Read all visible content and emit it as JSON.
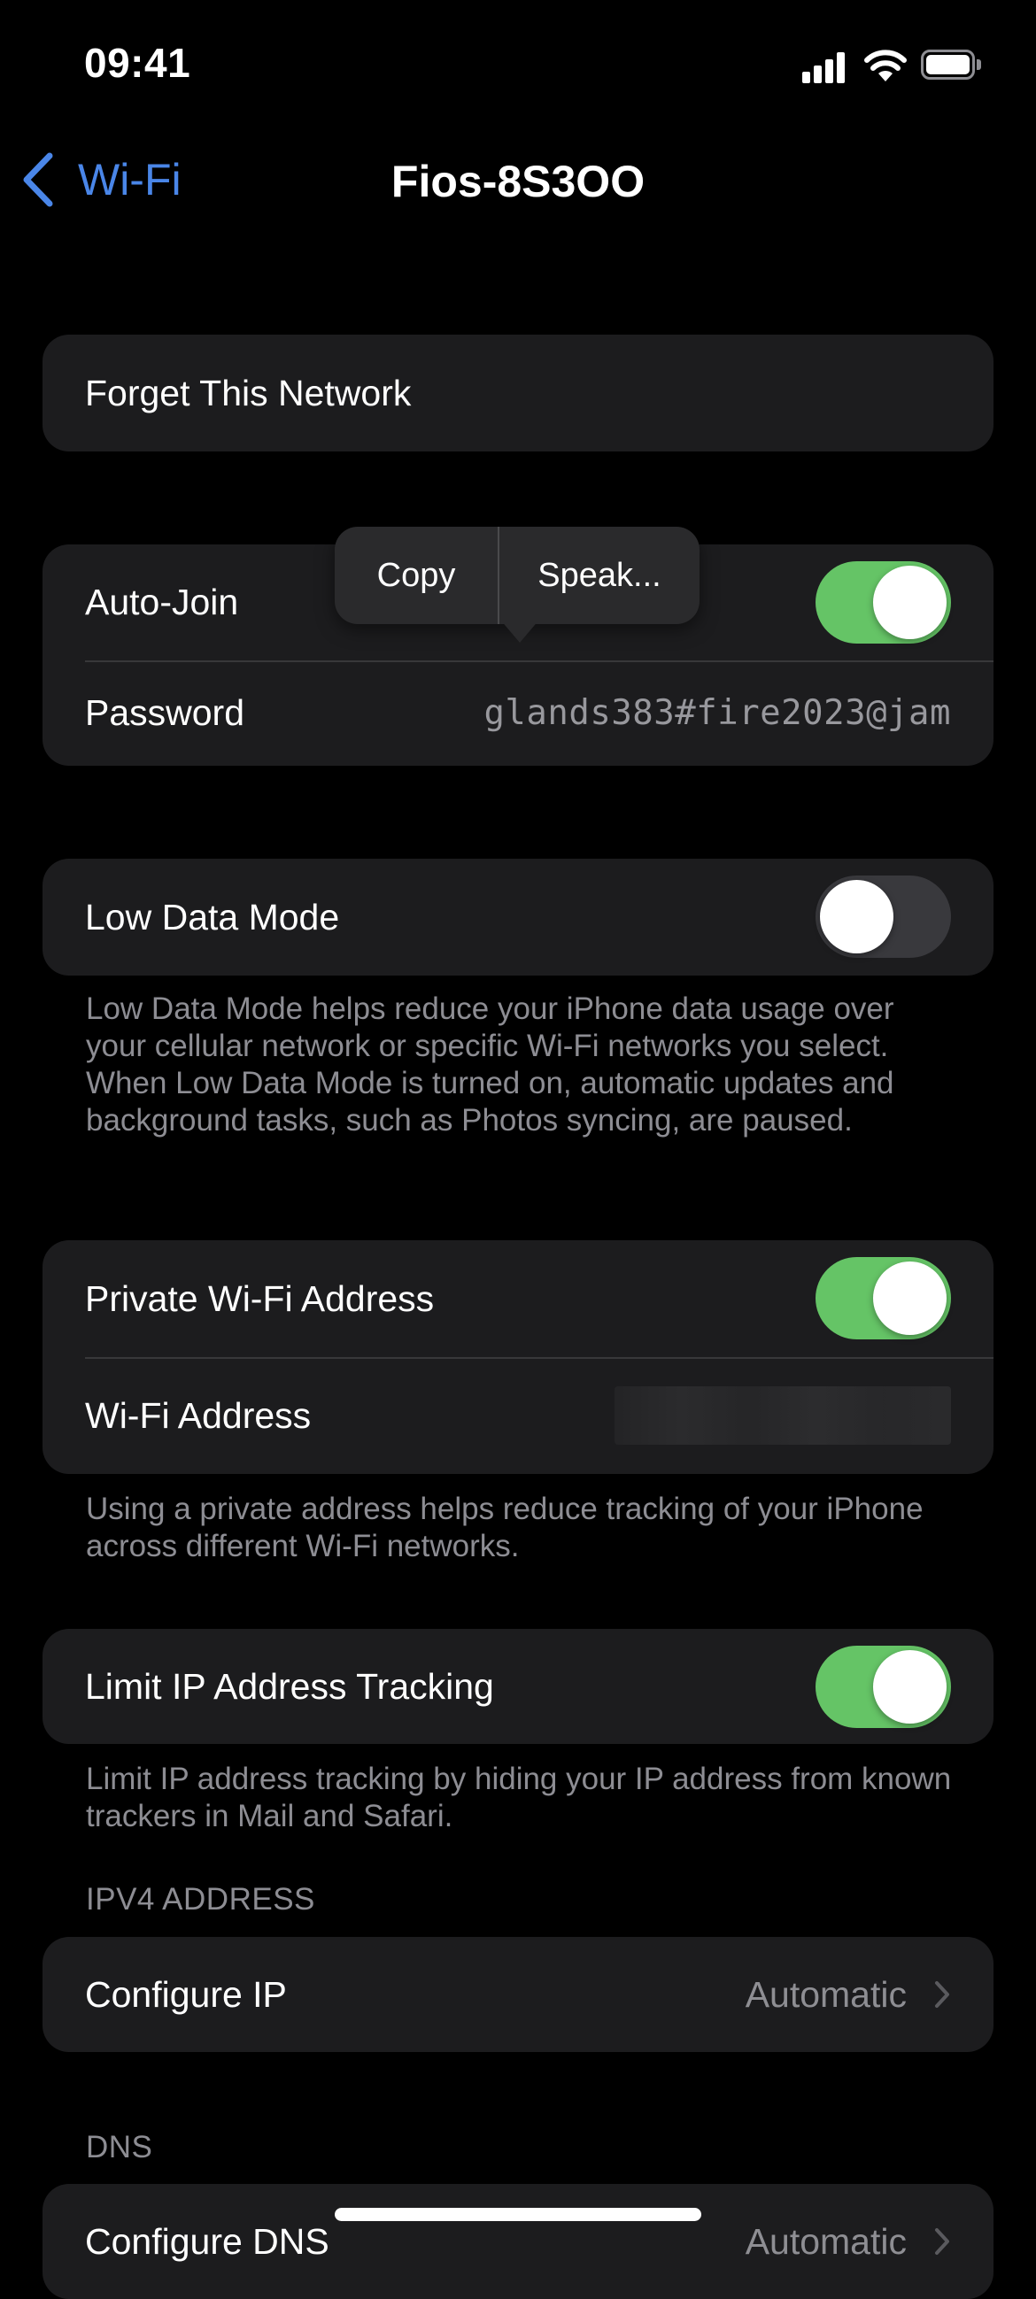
{
  "status_bar": {
    "time": "09:41"
  },
  "nav": {
    "back_label": "Wi-Fi",
    "title": "Fios-8S3OO"
  },
  "colors": {
    "accent": "#4a86e8",
    "toggle_on": "#65c466",
    "toggle_off": "#39393d",
    "card_bg": "#1c1c1e"
  },
  "forget": {
    "label": "Forget This Network"
  },
  "auto_join": {
    "label": "Auto-Join",
    "enabled": true
  },
  "password": {
    "label": "Password",
    "value": "glands383#fire2023@jam"
  },
  "popover": {
    "copy": "Copy",
    "speak": "Speak..."
  },
  "low_data": {
    "label": "Low Data Mode",
    "enabled": false,
    "footer": "Low Data Mode helps reduce your iPhone data usage over your cellular network or specific Wi-Fi networks you select. When Low Data Mode is turned on, automatic updates and background tasks, such as Photos syncing, are paused."
  },
  "private_address": {
    "label": "Private Wi-Fi Address",
    "enabled": true,
    "address_label": "Wi-Fi Address",
    "footer": "Using a private address helps reduce tracking of your iPhone across different Wi-Fi networks."
  },
  "limit_ip": {
    "label": "Limit IP Address Tracking",
    "enabled": true,
    "footer": "Limit IP address tracking by hiding your IP address from known trackers in Mail and Safari."
  },
  "ipv4": {
    "header": "IPV4 ADDRESS",
    "configure_label": "Configure IP",
    "configure_value": "Automatic"
  },
  "dns": {
    "header": "DNS",
    "configure_label": "Configure DNS",
    "configure_value": "Automatic"
  }
}
